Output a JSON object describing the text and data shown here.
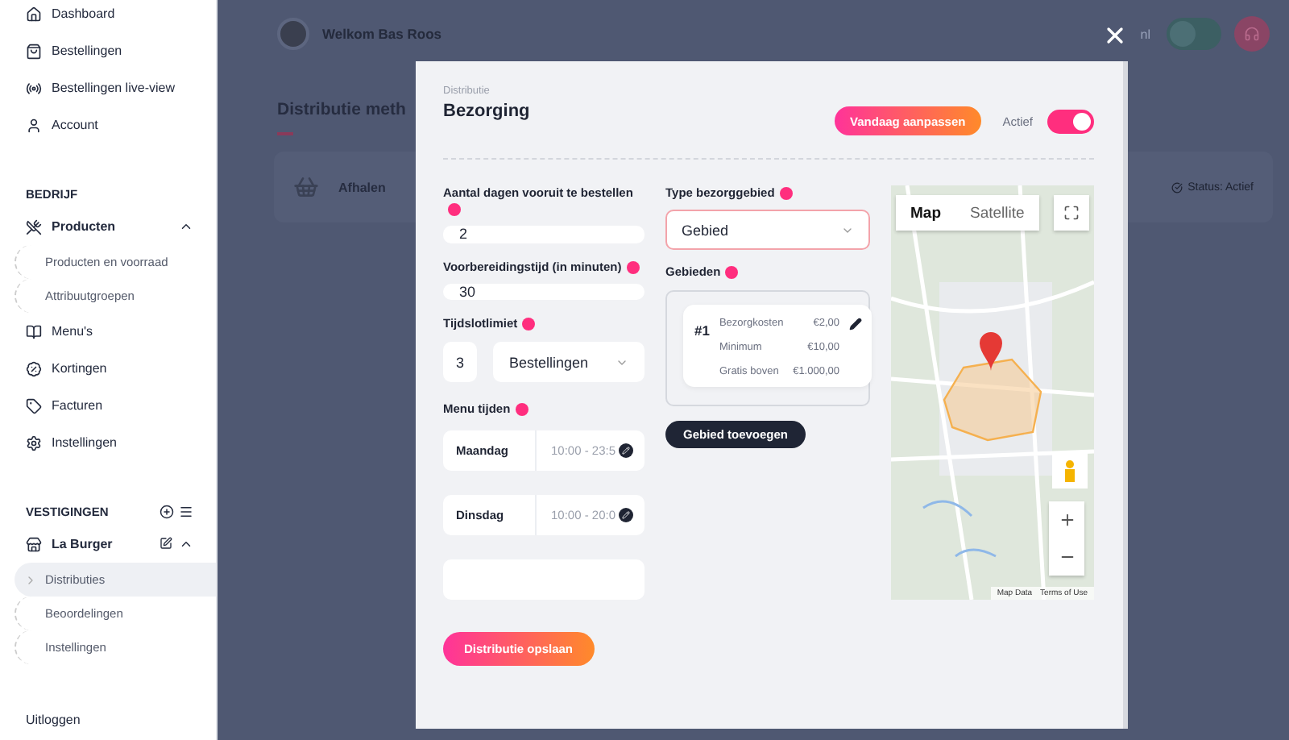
{
  "sidebar": {
    "items": [
      {
        "label": "Dashboard"
      },
      {
        "label": "Bestellingen"
      },
      {
        "label": "Bestellingen live-view"
      },
      {
        "label": "Account"
      }
    ],
    "sections": [
      {
        "title": "BEDRIJF",
        "items": [
          {
            "label": "Producten",
            "expanded": true,
            "children": [
              {
                "label": "Producten en voorraad",
                "selected": false
              },
              {
                "label": "Attribuutgroepen",
                "selected": false
              }
            ]
          },
          {
            "label": "Menu's"
          },
          {
            "label": "Kortingen"
          },
          {
            "label": "Facturen"
          },
          {
            "label": "Instellingen"
          }
        ]
      },
      {
        "title": "VESTIGINGEN",
        "items": [
          {
            "label": "La Burger",
            "expanded": true,
            "children": [
              {
                "label": "Distributies",
                "selected": true
              },
              {
                "label": "Beoordelingen",
                "selected": false
              },
              {
                "label": "Instellingen",
                "selected": false
              }
            ]
          }
        ]
      }
    ],
    "logout": "Uitloggen"
  },
  "header": {
    "greeting": "Welkom Bas Roos",
    "language": "nl",
    "theme_toggle_on": false
  },
  "page": {
    "title": "Distributie meth",
    "methods": [
      {
        "name": "Afhalen",
        "status": "Status: Actief"
      }
    ]
  },
  "modal": {
    "breadcrumb": "Distributie",
    "title": "Bezorging",
    "adjust_button": "Vandaag aanpassen",
    "active_label": "Actief",
    "active_on": true,
    "fields": [
      {
        "label": "Aantal dagen vooruit te bestellen",
        "value": "2"
      },
      {
        "label": "Voorbereidingstijd (in minuten)",
        "value": "30"
      }
    ],
    "timeslot": {
      "label": "Tijdslotlimiet",
      "value": "3",
      "unit": "Bestellingen"
    },
    "menu_times": {
      "label": "Menu tijden",
      "rows": [
        {
          "day": "Maandag",
          "time": "10:00 - 23:5"
        },
        {
          "day": "Dinsdag",
          "time": "10:00 - 20:0"
        }
      ]
    },
    "area_type": {
      "label": "Type bezorggebied",
      "value": "Gebied"
    },
    "areas": {
      "label": "Gebieden",
      "items": [
        {
          "number": "#1",
          "rows": [
            {
              "label": "Bezorgkosten",
              "value": "€2,00"
            },
            {
              "label": "Minimum",
              "value": "€10,00"
            },
            {
              "label": "Gratis boven",
              "value": "€1.000,00"
            }
          ]
        }
      ]
    },
    "add_area_button": "Gebied toevoegen",
    "map": {
      "tabs": [
        {
          "label": "Map",
          "selected": true
        },
        {
          "label": "Satellite",
          "selected": false
        }
      ],
      "attribution": [
        "Map Data",
        "Terms of Use"
      ]
    },
    "save_button": "Distributie opslaan"
  }
}
